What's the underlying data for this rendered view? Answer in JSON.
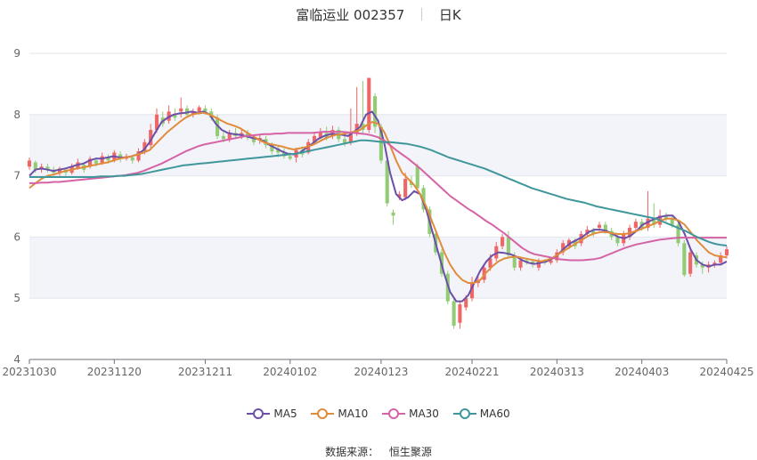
{
  "header": {
    "stock_name": "富临运业 002357",
    "period_label": "日K"
  },
  "source": {
    "label": "数据来源：",
    "name": "恒生聚源"
  },
  "colors": {
    "up": "#ee6666",
    "down": "#91cc75",
    "MA5": "#6b4fa8",
    "MA10": "#e08c3a",
    "MA30": "#d563a6",
    "MA60": "#3f979b",
    "band": "#f2f4f9"
  },
  "chart_data": {
    "type": "candlestick",
    "ylim": [
      4,
      9
    ],
    "yticks": [
      4,
      5,
      6,
      7,
      8,
      9
    ],
    "xtick_labels": [
      "20231030",
      "20231120",
      "20231211",
      "20240102",
      "20240123",
      "20240221",
      "20240313",
      "20240403",
      "20240425"
    ],
    "legend": [
      "MA5",
      "MA10",
      "MA30",
      "MA60"
    ],
    "candles": [
      {
        "d": "20231030",
        "o": 7.15,
        "c": 7.25,
        "h": 7.3,
        "l": 7.1
      },
      {
        "o": 7.22,
        "c": 7.1,
        "h": 7.25,
        "l": 7.05
      },
      {
        "o": 7.1,
        "c": 7.15,
        "h": 7.2,
        "l": 7.05
      },
      {
        "o": 7.15,
        "c": 7.1,
        "h": 7.2,
        "l": 7.05
      },
      {
        "o": 7.1,
        "c": 7.05,
        "h": 7.15,
        "l": 7.0
      },
      {
        "o": 7.05,
        "c": 7.12,
        "h": 7.15,
        "l": 7.0
      },
      {
        "o": 7.1,
        "c": 7.05,
        "h": 7.12,
        "l": 7.0
      },
      {
        "o": 7.05,
        "c": 7.15,
        "h": 7.2,
        "l": 7.02
      },
      {
        "o": 7.12,
        "c": 7.22,
        "h": 7.28,
        "l": 7.1
      },
      {
        "o": 7.18,
        "c": 7.1,
        "h": 7.22,
        "l": 7.05
      },
      {
        "o": 7.15,
        "c": 7.28,
        "h": 7.32,
        "l": 7.12
      },
      {
        "o": 7.25,
        "c": 7.2,
        "h": 7.3,
        "l": 7.15
      },
      {
        "o": 7.2,
        "c": 7.32,
        "h": 7.38,
        "l": 7.18
      },
      {
        "o": 7.3,
        "c": 7.25,
        "h": 7.35,
        "l": 7.2
      },
      {
        "d": "20231120",
        "o": 7.25,
        "c": 7.38,
        "h": 7.42,
        "l": 7.22
      },
      {
        "o": 7.35,
        "c": 7.28,
        "h": 7.4,
        "l": 7.22
      },
      {
        "o": 7.28,
        "c": 7.32,
        "h": 7.36,
        "l": 7.25
      },
      {
        "o": 7.3,
        "c": 7.25,
        "h": 7.33,
        "l": 7.2
      },
      {
        "o": 7.25,
        "c": 7.4,
        "h": 7.45,
        "l": 7.22
      },
      {
        "o": 7.4,
        "c": 7.55,
        "h": 7.6,
        "l": 7.35
      },
      {
        "o": 7.5,
        "c": 7.75,
        "h": 7.85,
        "l": 7.45
      },
      {
        "o": 7.75,
        "c": 8.0,
        "h": 8.1,
        "l": 7.7
      },
      {
        "o": 7.95,
        "c": 7.85,
        "h": 8.05,
        "l": 7.8
      },
      {
        "o": 7.9,
        "c": 8.05,
        "h": 8.15,
        "l": 7.85
      },
      {
        "o": 8.0,
        "c": 7.95,
        "h": 8.1,
        "l": 7.9
      },
      {
        "o": 8.05,
        "c": 8.1,
        "h": 8.28,
        "l": 7.95
      },
      {
        "o": 8.1,
        "c": 8.0,
        "h": 8.15,
        "l": 7.95
      },
      {
        "o": 8.0,
        "c": 8.05,
        "h": 8.1,
        "l": 7.95
      },
      {
        "o": 8.05,
        "c": 8.12,
        "h": 8.15,
        "l": 8.0
      },
      {
        "d": "20231211",
        "o": 8.1,
        "c": 8.05,
        "h": 8.15,
        "l": 8.0
      },
      {
        "o": 8.05,
        "c": 7.95,
        "h": 8.1,
        "l": 7.9
      },
      {
        "o": 7.95,
        "c": 7.65,
        "h": 8.0,
        "l": 7.6
      },
      {
        "o": 7.65,
        "c": 7.6,
        "h": 7.72,
        "l": 7.55
      },
      {
        "o": 7.6,
        "c": 7.7,
        "h": 7.75,
        "l": 7.55
      },
      {
        "o": 7.7,
        "c": 7.65,
        "h": 7.78,
        "l": 7.6
      },
      {
        "o": 7.65,
        "c": 7.7,
        "h": 7.75,
        "l": 7.6
      },
      {
        "o": 7.7,
        "c": 7.62,
        "h": 7.75,
        "l": 7.58
      },
      {
        "o": 7.62,
        "c": 7.55,
        "h": 7.68,
        "l": 7.5
      },
      {
        "o": 7.58,
        "c": 7.62,
        "h": 7.66,
        "l": 7.52
      },
      {
        "o": 7.6,
        "c": 7.5,
        "h": 7.65,
        "l": 7.45
      },
      {
        "o": 7.5,
        "c": 7.4,
        "h": 7.55,
        "l": 7.35
      },
      {
        "o": 7.45,
        "c": 7.38,
        "h": 7.5,
        "l": 7.3
      },
      {
        "o": 7.38,
        "c": 7.32,
        "h": 7.45,
        "l": 7.28
      },
      {
        "d": "20240102",
        "o": 7.32,
        "c": 7.28,
        "h": 7.38,
        "l": 7.25
      },
      {
        "o": 7.3,
        "c": 7.42,
        "h": 7.46,
        "l": 7.22
      },
      {
        "o": 7.42,
        "c": 7.35,
        "h": 7.48,
        "l": 7.3
      },
      {
        "o": 7.38,
        "c": 7.55,
        "h": 7.6,
        "l": 7.35
      },
      {
        "o": 7.55,
        "c": 7.65,
        "h": 7.7,
        "l": 7.5
      },
      {
        "o": 7.62,
        "c": 7.72,
        "h": 7.78,
        "l": 7.6
      },
      {
        "o": 7.7,
        "c": 7.62,
        "h": 7.8,
        "l": 7.58
      },
      {
        "o": 7.65,
        "c": 7.75,
        "h": 7.82,
        "l": 7.6
      },
      {
        "o": 7.75,
        "c": 7.6,
        "h": 7.8,
        "l": 7.55
      },
      {
        "o": 7.6,
        "c": 7.52,
        "h": 7.68,
        "l": 7.48
      },
      {
        "o": 7.55,
        "c": 7.7,
        "h": 8.1,
        "l": 7.5
      },
      {
        "o": 7.7,
        "c": 7.85,
        "h": 8.45,
        "l": 7.65
      },
      {
        "o": 7.85,
        "c": 7.75,
        "h": 8.55,
        "l": 7.7
      },
      {
        "o": 7.75,
        "c": 8.6,
        "h": 8.6,
        "l": 7.7
      },
      {
        "o": 8.3,
        "c": 7.8,
        "h": 8.35,
        "l": 7.7
      },
      {
        "d": "20240123",
        "o": 7.8,
        "c": 7.25,
        "h": 7.85,
        "l": 7.2
      },
      {
        "o": 7.25,
        "c": 6.55,
        "h": 7.3,
        "l": 6.5
      },
      {
        "o": 6.4,
        "c": 6.35,
        "h": 6.45,
        "l": 6.2
      },
      {
        "o": 6.65,
        "c": 6.7,
        "h": 6.75,
        "l": 6.6
      },
      {
        "o": 6.65,
        "c": 6.95,
        "h": 7.05,
        "l": 6.6
      },
      {
        "o": 6.9,
        "c": 6.85,
        "h": 7.0,
        "l": 6.8
      },
      {
        "o": 7.15,
        "c": 6.8,
        "h": 7.2,
        "l": 6.75
      },
      {
        "o": 6.8,
        "c": 6.45,
        "h": 6.85,
        "l": 6.4
      },
      {
        "o": 6.45,
        "c": 6.05,
        "h": 6.5,
        "l": 6.0
      },
      {
        "o": 6.05,
        "c": 5.75,
        "h": 6.1,
        "l": 5.7
      },
      {
        "o": 5.75,
        "c": 5.4,
        "h": 5.8,
        "l": 5.35
      },
      {
        "o": 5.4,
        "c": 4.95,
        "h": 5.45,
        "l": 4.9
      },
      {
        "o": 4.95,
        "c": 4.55,
        "h": 5.0,
        "l": 4.5
      },
      {
        "o": 4.6,
        "c": 4.9,
        "h": 4.95,
        "l": 4.5
      },
      {
        "o": 4.85,
        "c": 5.0,
        "h": 5.05,
        "l": 4.8
      },
      {
        "d": "20240221",
        "o": 5.0,
        "c": 5.25,
        "h": 5.35,
        "l": 4.95
      },
      {
        "o": 5.25,
        "c": 5.3,
        "h": 5.38,
        "l": 5.18
      },
      {
        "o": 5.3,
        "c": 5.5,
        "h": 5.55,
        "l": 5.25
      },
      {
        "o": 5.5,
        "c": 5.65,
        "h": 5.72,
        "l": 5.45
      },
      {
        "o": 5.65,
        "c": 5.85,
        "h": 5.92,
        "l": 5.6
      },
      {
        "o": 5.85,
        "c": 6.0,
        "h": 6.05,
        "l": 5.8
      },
      {
        "o": 6.0,
        "c": 5.7,
        "h": 6.1,
        "l": 5.65
      },
      {
        "o": 5.7,
        "c": 5.5,
        "h": 5.75,
        "l": 5.45
      },
      {
        "o": 5.5,
        "c": 5.62,
        "h": 5.68,
        "l": 5.45
      },
      {
        "o": 5.62,
        "c": 5.58,
        "h": 5.65,
        "l": 5.55
      },
      {
        "o": 5.6,
        "c": 5.55,
        "h": 5.62,
        "l": 5.5
      },
      {
        "o": 5.5,
        "c": 5.62,
        "h": 5.65,
        "l": 5.45
      },
      {
        "o": 5.6,
        "c": 5.58,
        "h": 5.64,
        "l": 5.55
      },
      {
        "o": 5.58,
        "c": 5.62,
        "h": 5.66,
        "l": 5.55
      },
      {
        "d": "20240313",
        "o": 5.62,
        "c": 5.75,
        "h": 5.8,
        "l": 5.58
      },
      {
        "o": 5.75,
        "c": 5.9,
        "h": 5.95,
        "l": 5.7
      },
      {
        "o": 5.85,
        "c": 5.95,
        "h": 5.98,
        "l": 5.8
      },
      {
        "o": 5.95,
        "c": 5.85,
        "h": 5.98,
        "l": 5.8
      },
      {
        "o": 5.9,
        "c": 6.05,
        "h": 6.1,
        "l": 5.85
      },
      {
        "o": 6.05,
        "c": 6.12,
        "h": 6.18,
        "l": 6.0
      },
      {
        "o": 6.1,
        "c": 6.05,
        "h": 6.15,
        "l": 6.0
      },
      {
        "o": 6.15,
        "c": 6.2,
        "h": 6.25,
        "l": 6.1
      },
      {
        "o": 6.2,
        "c": 6.1,
        "h": 6.25,
        "l": 6.05
      },
      {
        "o": 6.1,
        "c": 6.0,
        "h": 6.15,
        "l": 5.95
      },
      {
        "o": 6.0,
        "c": 5.9,
        "h": 6.05,
        "l": 5.85
      },
      {
        "o": 5.9,
        "c": 6.05,
        "h": 6.1,
        "l": 5.85
      },
      {
        "o": 6.0,
        "c": 6.15,
        "h": 6.2,
        "l": 5.95
      },
      {
        "o": 6.15,
        "c": 6.25,
        "h": 6.3,
        "l": 6.1
      },
      {
        "d": "20240403",
        "o": 6.25,
        "c": 6.15,
        "h": 6.3,
        "l": 6.1
      },
      {
        "o": 6.15,
        "c": 6.3,
        "h": 6.75,
        "l": 6.1
      },
      {
        "o": 6.3,
        "c": 6.2,
        "h": 6.55,
        "l": 6.15
      },
      {
        "o": 6.2,
        "c": 6.35,
        "h": 6.45,
        "l": 6.15
      },
      {
        "o": 6.35,
        "c": 6.3,
        "h": 6.4,
        "l": 6.25
      },
      {
        "o": 6.3,
        "c": 6.2,
        "h": 6.35,
        "l": 6.15
      },
      {
        "o": 6.2,
        "c": 5.9,
        "h": 6.25,
        "l": 5.85
      },
      {
        "o": 5.9,
        "c": 5.38,
        "h": 5.95,
        "l": 5.35
      },
      {
        "o": 5.4,
        "c": 5.75,
        "h": 5.8,
        "l": 5.35
      },
      {
        "o": 5.7,
        "c": 5.55,
        "h": 5.75,
        "l": 5.5
      },
      {
        "o": 5.55,
        "c": 5.5,
        "h": 5.6,
        "l": 5.4
      },
      {
        "o": 5.5,
        "c": 5.55,
        "h": 5.6,
        "l": 5.42
      },
      {
        "o": 5.55,
        "c": 5.58,
        "h": 5.62,
        "l": 5.5
      },
      {
        "o": 5.58,
        "c": 5.7,
        "h": 5.75,
        "l": 5.55
      },
      {
        "d": "20240425",
        "o": 5.7,
        "c": 5.8,
        "h": 5.85,
        "l": 5.65
      }
    ],
    "ma_series": [
      {
        "name": "MA5",
        "values": [
          7.0,
          7.1,
          7.12,
          7.1,
          7.08,
          7.1,
          7.12,
          7.15,
          7.18,
          7.2,
          7.25,
          7.28,
          7.28,
          7.3,
          7.32,
          7.3,
          7.3,
          7.32,
          7.35,
          7.42,
          7.55,
          7.72,
          7.88,
          7.95,
          8.0,
          8.02,
          8.03,
          8.05,
          8.03,
          8.05,
          8.0,
          7.85,
          7.75,
          7.7,
          7.68,
          7.67,
          7.65,
          7.62,
          7.6,
          7.57,
          7.5,
          7.45,
          7.4,
          7.36,
          7.35,
          7.38,
          7.45,
          7.52,
          7.6,
          7.65,
          7.68,
          7.68,
          7.67,
          7.65,
          7.72,
          7.8,
          8.0,
          8.05,
          7.9,
          7.55,
          7.05,
          6.7,
          6.6,
          6.65,
          6.75,
          6.7,
          6.45,
          6.1,
          5.75,
          5.4,
          5.1,
          4.95,
          4.95,
          5.05,
          5.25,
          5.45,
          5.6,
          5.7,
          5.75,
          5.74,
          5.72,
          5.68,
          5.62,
          5.58,
          5.56,
          5.58,
          5.6,
          5.65,
          5.72,
          5.82,
          5.9,
          5.95,
          6.0,
          6.08,
          6.12,
          6.12,
          6.1,
          6.05,
          6.0,
          5.98,
          6.02,
          6.1,
          6.2,
          6.25,
          6.3,
          6.33,
          6.35,
          6.35,
          6.25,
          6.05,
          5.8,
          5.62,
          5.55,
          5.52,
          5.55,
          5.55,
          5.6
        ]
      },
      {
        "name": "MA10",
        "values": [
          6.8,
          6.88,
          6.95,
          7.0,
          7.02,
          7.05,
          7.08,
          7.1,
          7.12,
          7.14,
          7.16,
          7.18,
          7.2,
          7.22,
          7.25,
          7.28,
          7.3,
          7.32,
          7.35,
          7.38,
          7.42,
          7.52,
          7.62,
          7.72,
          7.8,
          7.88,
          7.95,
          8.0,
          8.02,
          8.03,
          8.0,
          7.95,
          7.9,
          7.85,
          7.82,
          7.78,
          7.72,
          7.66,
          7.6,
          7.55,
          7.52,
          7.5,
          7.48,
          7.45,
          7.43,
          7.45,
          7.47,
          7.5,
          7.55,
          7.6,
          7.64,
          7.67,
          7.68,
          7.7,
          7.72,
          7.75,
          7.82,
          7.88,
          7.85,
          7.72,
          7.5,
          7.25,
          7.05,
          6.95,
          6.85,
          6.7,
          6.5,
          6.25,
          6.0,
          5.75,
          5.55,
          5.4,
          5.3,
          5.25,
          5.25,
          5.3,
          5.42,
          5.52,
          5.6,
          5.65,
          5.67,
          5.68,
          5.66,
          5.64,
          5.62,
          5.6,
          5.62,
          5.66,
          5.72,
          5.78,
          5.84,
          5.9,
          5.96,
          6.02,
          6.06,
          6.08,
          6.08,
          6.06,
          6.05,
          6.05,
          6.07,
          6.1,
          6.14,
          6.18,
          6.22,
          6.27,
          6.3,
          6.3,
          6.27,
          6.2,
          6.08,
          5.95,
          5.85,
          5.75,
          5.7,
          5.68,
          5.67
        ]
      },
      {
        "name": "MA30",
        "values": [
          6.88,
          6.88,
          6.89,
          6.89,
          6.9,
          6.9,
          6.91,
          6.92,
          6.93,
          6.94,
          6.95,
          6.96,
          6.97,
          6.98,
          6.99,
          7.0,
          7.01,
          7.03,
          7.05,
          7.08,
          7.12,
          7.16,
          7.2,
          7.25,
          7.3,
          7.35,
          7.4,
          7.44,
          7.48,
          7.51,
          7.53,
          7.55,
          7.57,
          7.59,
          7.61,
          7.63,
          7.65,
          7.66,
          7.67,
          7.68,
          7.68,
          7.69,
          7.69,
          7.7,
          7.7,
          7.7,
          7.7,
          7.7,
          7.71,
          7.72,
          7.72,
          7.72,
          7.72,
          7.71,
          7.7,
          7.69,
          7.68,
          7.66,
          7.63,
          7.58,
          7.5,
          7.42,
          7.35,
          7.28,
          7.2,
          7.12,
          7.03,
          6.94,
          6.85,
          6.76,
          6.67,
          6.6,
          6.53,
          6.46,
          6.4,
          6.33,
          6.26,
          6.2,
          6.13,
          6.06,
          5.98,
          5.9,
          5.82,
          5.76,
          5.72,
          5.7,
          5.68,
          5.66,
          5.64,
          5.63,
          5.62,
          5.62,
          5.62,
          5.63,
          5.64,
          5.66,
          5.7,
          5.74,
          5.78,
          5.82,
          5.85,
          5.88,
          5.9,
          5.92,
          5.94,
          5.96,
          5.97,
          5.98,
          5.99,
          5.99,
          5.99,
          5.99,
          5.99,
          5.99,
          5.99,
          5.99,
          5.99
        ]
      },
      {
        "name": "MA60",
        "values": [
          6.98,
          6.98,
          6.98,
          6.98,
          6.98,
          6.98,
          6.98,
          6.98,
          6.98,
          6.98,
          6.98,
          6.98,
          6.99,
          6.99,
          6.99,
          7.0,
          7.0,
          7.01,
          7.02,
          7.03,
          7.05,
          7.07,
          7.09,
          7.11,
          7.13,
          7.15,
          7.17,
          7.18,
          7.19,
          7.2,
          7.21,
          7.22,
          7.23,
          7.24,
          7.25,
          7.26,
          7.27,
          7.28,
          7.29,
          7.3,
          7.31,
          7.32,
          7.33,
          7.34,
          7.35,
          7.36,
          7.38,
          7.4,
          7.42,
          7.44,
          7.46,
          7.48,
          7.5,
          7.52,
          7.54,
          7.56,
          7.58,
          7.58,
          7.57,
          7.56,
          7.55,
          7.55,
          7.54,
          7.53,
          7.52,
          7.5,
          7.48,
          7.45,
          7.42,
          7.38,
          7.34,
          7.3,
          7.27,
          7.24,
          7.21,
          7.18,
          7.15,
          7.12,
          7.08,
          7.04,
          7.0,
          6.96,
          6.92,
          6.88,
          6.84,
          6.8,
          6.77,
          6.74,
          6.71,
          6.68,
          6.65,
          6.62,
          6.6,
          6.58,
          6.56,
          6.53,
          6.5,
          6.48,
          6.46,
          6.44,
          6.42,
          6.4,
          6.38,
          6.36,
          6.34,
          6.32,
          6.3,
          6.26,
          6.22,
          6.18,
          6.14,
          6.1,
          6.05,
          6.0,
          5.96,
          5.92,
          5.89,
          5.87,
          5.86
        ]
      }
    ]
  }
}
